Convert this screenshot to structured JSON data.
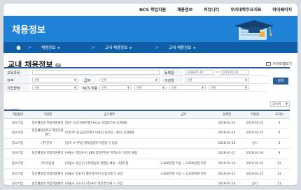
{
  "nav": {
    "items": [
      "NCS 학업지원",
      "채용정보",
      "커뮤니티",
      "우리대학주요지표",
      "마이페이지"
    ]
  },
  "hero": {
    "title": "채용정보"
  },
  "breadcrumb": {
    "items": [
      "채용정보",
      "교내 채용정보",
      "교내 채용정보"
    ]
  },
  "page": {
    "title": "교내 채용정보",
    "help_label": "?",
    "guide_label": "사이트맵보기"
  },
  "search_form": {
    "labels": {
      "company": "교육과목",
      "region": "지역",
      "corp_type": "기업형태",
      "salary": "급여",
      "ncs": "NCS 직종",
      "reg_date": "등록일",
      "deadline": "마감일"
    },
    "fields": {
      "region": "선택",
      "salary": "선택",
      "corp_type": "선택",
      "ncs1": "선택",
      "ncs2": "선택",
      "ncs3": "선택",
      "ncs4": "선택",
      "reg_from": "2018-07-24",
      "reg_to": "2019-01-24",
      "deadline": "선택"
    },
    "search_button": "검색"
  },
  "results": {
    "count_prefix": "총",
    "count": "167",
    "count_suffix": "건",
    "page_size": "10개씩"
  },
  "table": {
    "headers": [
      "기업형태",
      "기업명",
      "공고제목",
      "급여",
      "등록일",
      "마감일",
      "조회수"
    ],
    "rows": [
      [
        "중소기업",
        "동인웰빙대 취업지원센터",
        "[접수 55건지원진행] K-Car 사업팀기사 공개채용",
        "",
        "2018-01-24",
        "2019-01-25",
        "0"
      ],
      [
        "중소기업",
        "동인웰빙대학교 취업지원센터",
        "[인턴/주 팀]금상의테크 대표팀 방문팀 - 40건 공개채용",
        "",
        "2018-01-24",
        "2019-01-25",
        "0"
      ],
      [
        "중소기업",
        "(주)한국 -",
        "[정기 브 루팀] 멘토링팀학 지원형 인 팀장",
        "",
        "2018-01-18",
        "상시",
        "6"
      ],
      [
        "중소기업",
        "동인웰빙대 취업지원센터",
        "[서울시 영등포구] KBS 영상콘텐츠 미래소프 가정직 채용",
        "",
        "2018-01-17",
        "2018-01-30",
        "9"
      ],
      [
        "중소기업",
        "(주)자동실",
        "[서울시 강남구] (주)영등실 경영팀 채용 - 2명모집",
        "2,400만원 이상 ~ 2,600만원 미만",
        "2019-01-16",
        "2019-01-25",
        "12"
      ],
      [
        "중소기업",
        "동인웰빙대 취업지원센터",
        "[서울시 마포구] 헬로앤 아이 산업시행 드 모집",
        "3,000만원 이상 ~ 3,200만원 미만",
        "2019-01-15",
        "2019-01-25",
        "12"
      ],
      [
        "중소기업",
        "동인웰빙대 취업지원센터",
        "[서울시 구로구] (주)푸르 영문경리/회 드 모집",
        "",
        "2019-01-14",
        "상시",
        "11"
      ]
    ]
  }
}
